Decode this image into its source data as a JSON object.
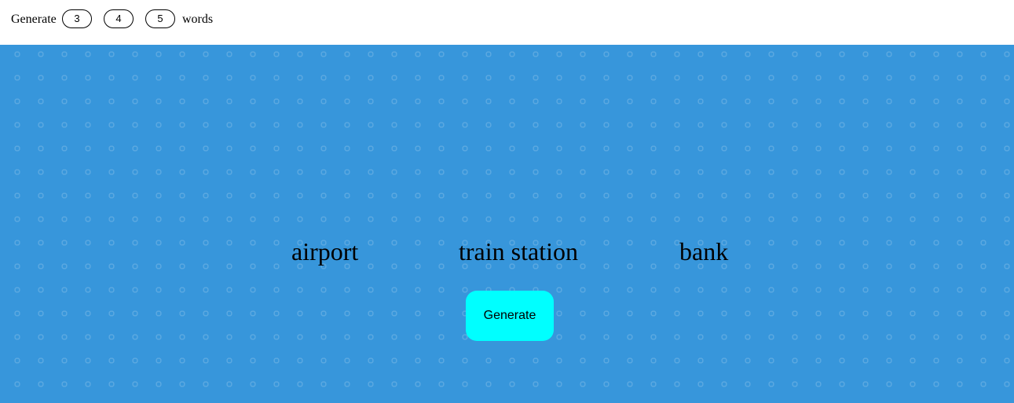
{
  "header": {
    "generate_label": "Generate",
    "counts": [
      "3",
      "4",
      "5"
    ],
    "words_label": "words"
  },
  "main": {
    "words": [
      "airport",
      "train station",
      "bank"
    ],
    "generate_button_label": "Generate"
  },
  "colors": {
    "background": "#3796db",
    "button": "#00ffff",
    "header_bg": "#ffffff"
  }
}
